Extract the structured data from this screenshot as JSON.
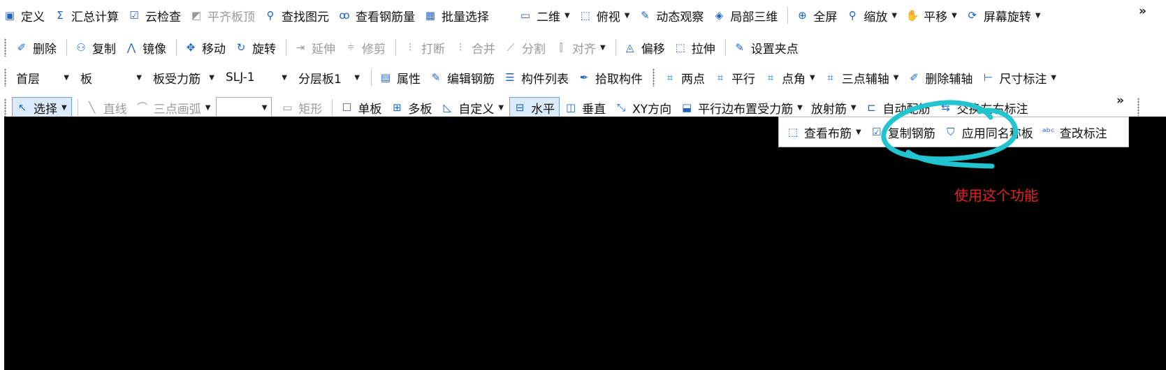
{
  "toolbar_row1": {
    "items": [
      {
        "label": "定义",
        "icon": "define-icon",
        "glyph": "▣"
      },
      {
        "label": "汇总计算",
        "icon": "sigma-icon",
        "glyph": "Σ"
      },
      {
        "label": "云检查",
        "icon": "cloud-check-icon",
        "glyph": "☑"
      },
      {
        "label": "平齐板顶",
        "icon": "align-slab-top-icon",
        "glyph": "◩",
        "disabled": true
      },
      {
        "label": "查找图元",
        "icon": "binoculars-icon",
        "glyph": "⚲"
      },
      {
        "label": "查看钢筋量",
        "icon": "rebar-quantity-icon",
        "glyph": "ꝏ"
      },
      {
        "label": "批量选择",
        "icon": "batch-select-icon",
        "glyph": "▦"
      }
    ],
    "view_items": [
      {
        "label": "二维",
        "icon": "2d-view-icon",
        "glyph": "▭",
        "dropdown": true
      },
      {
        "label": "俯视",
        "icon": "top-view-icon",
        "glyph": "⬚",
        "dropdown": true
      },
      {
        "label": "动态观察",
        "icon": "orbit-icon",
        "glyph": "✎"
      },
      {
        "label": "局部三维",
        "icon": "partial-3d-icon",
        "glyph": "◈"
      },
      {
        "label": "全屏",
        "icon": "fullscreen-icon",
        "glyph": "⊕"
      },
      {
        "label": "缩放",
        "icon": "zoom-icon",
        "glyph": "⚲",
        "dropdown": true
      },
      {
        "label": "平移",
        "icon": "pan-icon",
        "glyph": "✋",
        "dropdown": true
      },
      {
        "label": "屏幕旋转",
        "icon": "screen-rotate-icon",
        "glyph": "⟳",
        "dropdown": true
      }
    ],
    "overflow": "»"
  },
  "toolbar_row2": {
    "items": [
      {
        "label": "删除",
        "icon": "delete-icon",
        "glyph": "✐"
      },
      {
        "label": "复制",
        "icon": "copy-icon",
        "glyph": "⚇"
      },
      {
        "label": "镜像",
        "icon": "mirror-icon",
        "glyph": "⋀"
      },
      {
        "label": "移动",
        "icon": "move-icon",
        "glyph": "✥"
      },
      {
        "label": "旋转",
        "icon": "rotate-icon",
        "glyph": "↻"
      },
      {
        "label": "延伸",
        "icon": "extend-icon",
        "glyph": "⇥",
        "disabled": true
      },
      {
        "label": "修剪",
        "icon": "trim-icon",
        "glyph": "⫩",
        "disabled": true
      },
      {
        "label": "打断",
        "icon": "break-icon",
        "glyph": "⫶",
        "disabled": true
      },
      {
        "label": "合并",
        "icon": "merge-icon",
        "glyph": "⫶",
        "disabled": true
      },
      {
        "label": "分割",
        "icon": "split-icon",
        "glyph": "⟋",
        "disabled": true
      },
      {
        "label": "对齐",
        "icon": "align-icon",
        "glyph": "⫿",
        "disabled": true,
        "dropdown": true
      },
      {
        "label": "偏移",
        "icon": "offset-icon",
        "glyph": "◬"
      },
      {
        "label": "拉伸",
        "icon": "stretch-icon",
        "glyph": "⬚"
      },
      {
        "label": "设置夹点",
        "icon": "grip-point-icon",
        "glyph": "✎"
      }
    ]
  },
  "toolbar_row3": {
    "floor_select": "首层",
    "element_type_select": "板",
    "rebar_type_select": "板受力筋",
    "spec_select": "SLJ-1",
    "layer_select": "分层板1",
    "items": [
      {
        "label": "属性",
        "icon": "properties-icon",
        "glyph": "▤"
      },
      {
        "label": "编辑钢筋",
        "icon": "edit-rebar-icon",
        "glyph": "✎"
      },
      {
        "label": "构件列表",
        "icon": "component-list-icon",
        "glyph": "☰"
      },
      {
        "label": "拾取构件",
        "icon": "pick-component-icon",
        "glyph": "✒"
      }
    ],
    "axis_items": [
      {
        "label": "两点",
        "icon": "two-point-axis-icon",
        "glyph": "⌗"
      },
      {
        "label": "平行",
        "icon": "parallel-axis-icon",
        "glyph": "⌗"
      },
      {
        "label": "点角",
        "icon": "point-angle-axis-icon",
        "glyph": "⌗",
        "dropdown": true
      },
      {
        "label": "三点辅轴",
        "icon": "three-point-axis-icon",
        "glyph": "⌗",
        "dropdown": true
      },
      {
        "label": "删除辅轴",
        "icon": "delete-axis-icon",
        "glyph": "✐"
      },
      {
        "label": "尺寸标注",
        "icon": "dimension-icon",
        "glyph": "⊢",
        "dropdown": true
      }
    ]
  },
  "toolbar_row4": {
    "items": [
      {
        "label": "选择",
        "icon": "select-cursor-icon",
        "glyph": "↖",
        "active": true,
        "dropdown": true
      },
      {
        "label": "直线",
        "icon": "line-icon",
        "glyph": "╲",
        "disabled": true
      },
      {
        "label": "三点画弧",
        "icon": "arc-icon",
        "glyph": "⌒",
        "disabled": true,
        "dropdown": true
      }
    ],
    "items_after_field": [
      {
        "label": "矩形",
        "icon": "rectangle-icon",
        "glyph": "▭",
        "disabled": true
      },
      {
        "label": "单板",
        "icon": "single-slab-icon",
        "glyph": "☐"
      },
      {
        "label": "多板",
        "icon": "multi-slab-icon",
        "glyph": "⊞"
      },
      {
        "label": "自定义",
        "icon": "custom-icon",
        "glyph": "◺",
        "dropdown": true
      },
      {
        "label": "水平",
        "icon": "horizontal-icon",
        "glyph": "⊟",
        "active": true
      },
      {
        "label": "垂直",
        "icon": "vertical-icon",
        "glyph": "◫"
      },
      {
        "label": "XY方向",
        "icon": "xy-direction-icon",
        "glyph": "⤡"
      },
      {
        "label": "平行边布置受力筋",
        "icon": "parallel-edge-rebar-icon",
        "glyph": "⬓",
        "dropdown": true
      },
      {
        "label": "放射筋",
        "icon": "radial-rebar-icon",
        "glyph": "",
        "dropdown": true
      },
      {
        "label": "自动配筋",
        "icon": "auto-rebar-icon",
        "glyph": "⊏"
      },
      {
        "label": "交换左右标注",
        "icon": "swap-labels-icon",
        "glyph": "⇆"
      }
    ],
    "overflow": "»"
  },
  "popup": {
    "items": [
      {
        "label": "查看布筋",
        "icon": "view-rebar-layout-icon",
        "glyph": "⬚",
        "dropdown": true
      },
      {
        "label": "复制钢筋",
        "icon": "copy-rebar-icon",
        "glyph": "☑"
      },
      {
        "label": "应用同名称板",
        "icon": "apply-same-name-slab-icon",
        "glyph": "⛉"
      },
      {
        "label": "查改标注",
        "icon": "edit-annotation-icon",
        "glyph": "ᵃᵇᶜ"
      }
    ]
  },
  "annotation": {
    "text": "使用这个功能",
    "color": "#e02424",
    "circle_color": "#21c4cf"
  },
  "canvas_color": "#000000"
}
